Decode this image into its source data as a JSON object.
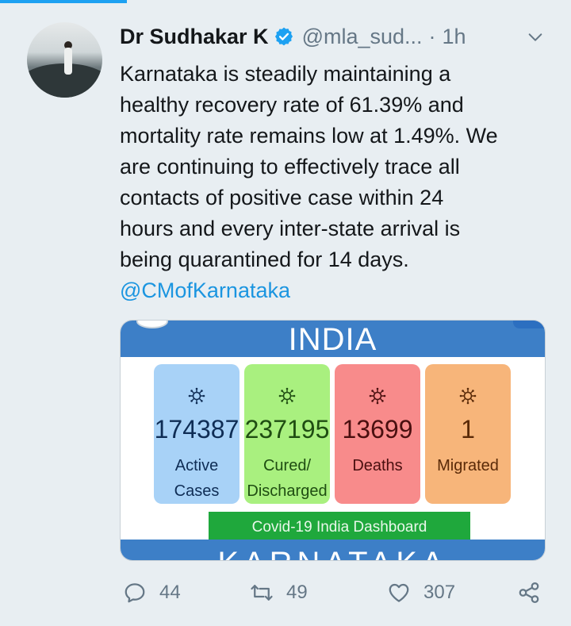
{
  "tweet": {
    "author_name": "Dr Sudhakar K",
    "handle": "@mla_sud...",
    "separator": "·",
    "time": "1h",
    "text_lines": [
      "Karnataka is steadily maintaining a",
      "healthy recovery rate of 61.39% and",
      "mortality rate remains low at 1.49%. We",
      "are continuing to effectively trace all",
      "contacts of positive case within 24",
      "hours and every inter-state arrival is",
      "being quarantined for 14 days."
    ],
    "mention": "@CMofKarnataka"
  },
  "card": {
    "region_title": "INDIA",
    "next_region_title": "KARNATAKA",
    "stats": [
      {
        "value": "174387",
        "label_lines": [
          "Active",
          "Cases"
        ],
        "bg": "#a8d2f7",
        "fg": "#0f2d55"
      },
      {
        "value": "237195",
        "label_lines": [
          "Cured/",
          "Discharged"
        ],
        "bg": "#a9f07f",
        "fg": "#1f4d12"
      },
      {
        "value": "13699",
        "label_lines": [
          "Deaths",
          ""
        ],
        "bg": "#f88b8b",
        "fg": "#4a0f0f"
      },
      {
        "value": "1",
        "label_lines": [
          "Migrated",
          ""
        ],
        "bg": "#f7b57a",
        "fg": "#5a2a08"
      }
    ],
    "dashboard_label": "Covid-19 India Dashboard"
  },
  "actions": {
    "replies": "44",
    "retweets": "49",
    "likes": "307"
  },
  "icons": {
    "verified": "verified-badge-icon",
    "chevron": "chevron-down-icon",
    "reply": "reply-icon",
    "retweet": "retweet-icon",
    "like": "heart-icon",
    "share": "share-icon",
    "virus": "virus-icon"
  },
  "colors": {
    "accent": "#1da1f2",
    "mention": "#1b95e0",
    "card_blue": "#3d7fc7",
    "dashboard_green": "#1fa83c"
  }
}
